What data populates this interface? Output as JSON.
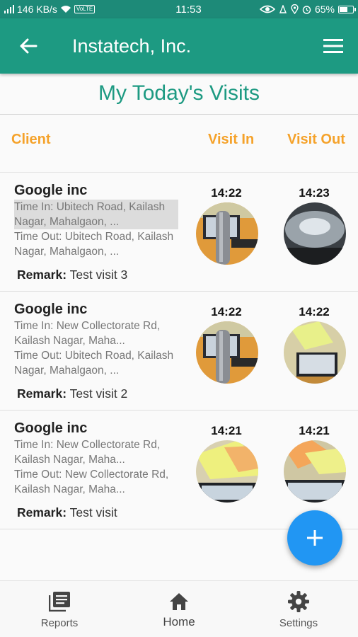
{
  "status_bar": {
    "speed": "146 KB/s",
    "volte": "VoLTE",
    "time": "11:53",
    "battery": "65%",
    "battery_level": 0.65
  },
  "app_bar": {
    "title": "Instatech, Inc.",
    "back_icon": "arrow-back-icon",
    "menu_icon": "hamburger-menu-icon"
  },
  "page": {
    "title": "My Today's Visits"
  },
  "columns": {
    "client": "Client",
    "visit_in": "Visit In",
    "visit_out": "Visit Out"
  },
  "visits": [
    {
      "client": "Google inc",
      "time_in_label": "Time In: Ubitech Road, Kailash Nagar, Mahalgaon, ...",
      "time_out_label": "Time Out: Ubitech Road, Kailash Nagar, Mahalgaon, ...",
      "remark_label": "Remark:",
      "remark": "Test visit 3",
      "visit_in_time": "14:22",
      "visit_out_time": "14:23"
    },
    {
      "client": "Google inc",
      "time_in_label": "Time In: New Collectorate Rd, Kailash Nagar, Maha...",
      "time_out_label": "Time Out: Ubitech Road, Kailash Nagar, Mahalgaon, ...",
      "remark_label": "Remark:",
      "remark": "Test visit 2",
      "visit_in_time": "14:22",
      "visit_out_time": "14:22"
    },
    {
      "client": "Google inc",
      "time_in_label": "Time In: New Collectorate Rd, Kailash Nagar, Maha...",
      "time_out_label": "Time Out: New Collectorate Rd, Kailash Nagar, Maha...",
      "remark_label": "Remark:",
      "remark": "Test visit",
      "visit_in_time": "14:21",
      "visit_out_time": "14:21"
    }
  ],
  "fab": {
    "icon": "plus-icon"
  },
  "bottom_nav": [
    {
      "label": "Reports",
      "icon": "reports-icon"
    },
    {
      "label": "Home",
      "icon": "home-icon"
    },
    {
      "label": "Settings",
      "icon": "gear-icon"
    }
  ],
  "colors": {
    "primary": "#1d9a82",
    "accent_orange": "#f5a22a",
    "fab_blue": "#2196f3"
  }
}
